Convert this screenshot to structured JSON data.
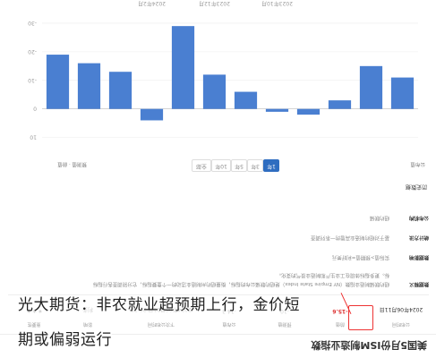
{
  "page": {
    "title": "美国5月份ISM制造业指数"
  },
  "summary": {
    "cells": [
      {
        "label": "公布时间",
        "value": "2024年06月11日",
        "red": false
      },
      {
        "label": "前值",
        "value": "-15.6",
        "red": true
      },
      {
        "label": "预测值",
        "value": "-10",
        "red": false
      },
      {
        "label": "公布值",
        "value": "-14.3",
        "red": false
      },
      {
        "label": "下次公布时间",
        "value": "2024年06月11日 20:30",
        "red": false
      },
      {
        "label": "影响",
        "value": "利多",
        "red": false
      },
      {
        "label": "重要性",
        "value": "★★★",
        "red": false
      }
    ]
  },
  "definitions": [
    {
      "key": "数据释义",
      "value": "纽约联储制造业指数（NY Empire State Index）是纽约联储公布的指标，衡量纽约州制造业活动的一个重要指标，它分别调查各行指标"
    },
    {
      "key": "",
      "value": "标。更多指标体现在工业生产和制造业景气的变化。"
    },
    {
      "key": "数据影响",
      "value": "实际值>预期值=利好美元"
    },
    {
      "key": "统计方法",
      "value": "基于对纽约制造业高管的一系列调查"
    },
    {
      "key": "公布机构",
      "value": "纽约联储"
    }
  ],
  "history": {
    "title": "历史数据",
    "tabs": [
      "1年",
      "3年",
      "5年",
      "10年",
      "全部"
    ],
    "active_tab": "1年",
    "legend_left": "公布值",
    "legend_right": "预测值 · 前值"
  },
  "chart_data": {
    "type": "bar",
    "categories": [
      "2023年6月",
      "2023年7月",
      "2023年8月",
      "2023年9月",
      "2023年10月",
      "2023年11月",
      "2023年12月",
      "2024年1月",
      "2024年2月",
      "2024年3月",
      "2024年4月",
      "2024年5月"
    ],
    "values": [
      -11,
      -15,
      -3,
      2,
      1,
      -6,
      -12,
      -29,
      4,
      -13,
      -16,
      -19
    ],
    "ylim": [
      -35,
      12
    ],
    "y_ticks": [
      10,
      0,
      -10,
      -20,
      -30
    ],
    "x_ticks_shown": [
      "2023年10月",
      "2023年12月",
      "2024年2月"
    ],
    "bar_color": "#4a7fd1"
  },
  "overlay": {
    "line1": "光大期货：非农就业超预期上行，金价短",
    "line2": "期或偏弱运行"
  }
}
